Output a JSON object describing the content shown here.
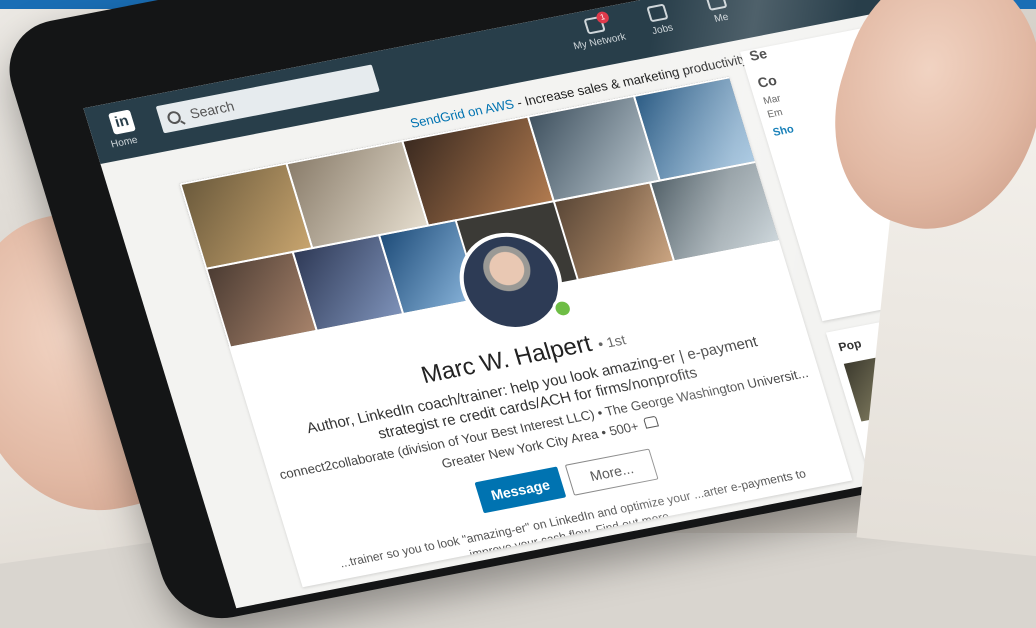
{
  "navbar": {
    "logo": "in",
    "home_label": "Home",
    "search_placeholder": "Search",
    "my_network_label": "My Network",
    "my_network_badge": "1",
    "jobs_label": "Jobs",
    "messaging_label": "Me"
  },
  "ad": {
    "link_text": "SendGrid on AWS",
    "text": " - Increase sales & marketing productivity with SendGrid. Launch in..."
  },
  "profile": {
    "name": "Marc W. Halpert",
    "degree": "• 1st",
    "headline": "Author, LinkedIn coach/trainer: help you look amazing-er | e-payment strategist re credit cards/ACH for firms/nonprofits",
    "company": "connect2collaborate (division of Your Best Interest LLC) • The George Washington Universit...",
    "location": "Greater New York City Area • 500+",
    "message_button": "Message",
    "more_button": "More...",
    "summary": "...trainer so you to look \"amazing-er\" on LinkedIn and optimize your ...arter e-payments to improve your cash flow. Find out more. ..."
  },
  "sidebar": {
    "top_label": "Se",
    "contact_title": "Co",
    "contact_lines": [
      "Mar",
      "Em"
    ],
    "show_link": "Sho",
    "popular_label": "Pop"
  },
  "colors": {
    "linkedin_blue": "#0073b1",
    "navbar": "#283e4a",
    "online_green": "#6ebd45"
  }
}
